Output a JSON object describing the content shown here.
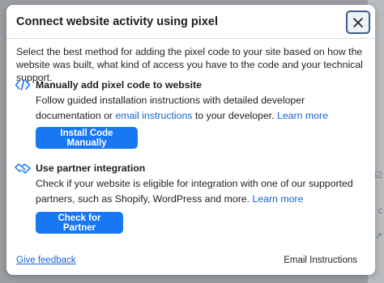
{
  "modal": {
    "title": "Connect website activity using pixel",
    "intro": "Select the best method for adding the pixel code to your site based on how the website was built, what kind of access you have to the code and your technical support."
  },
  "sections": [
    {
      "title": "Manually add pixel code to website",
      "text_before": "Follow guided installation instructions with detailed developer documentation or",
      "inline_link": "email instructions",
      "text_after": "to your developer.",
      "learn_more": "Learn more",
      "button": "Install Code Manually",
      "icon": "code-icon"
    },
    {
      "title": "Use partner integration",
      "text_before": "Check if your website is eligible for integration with one of our supported partners, such as Shopify, WordPress and more.",
      "learn_more": "Learn more",
      "button": "Check for Partner",
      "icon": "handshake-icon"
    }
  ],
  "footer": {
    "feedback_link": "Give feedback",
    "right_action": "Email Instructions"
  },
  "colors": {
    "primary": "#1877f2",
    "link": "#1763cf"
  }
}
